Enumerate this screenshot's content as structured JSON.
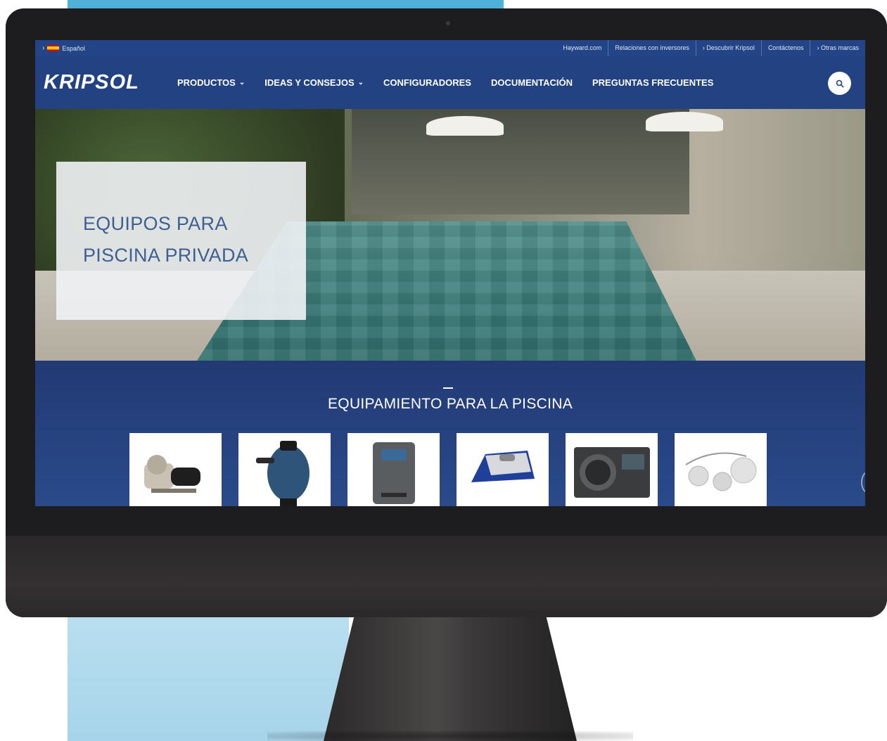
{
  "topbar": {
    "language": "Español",
    "links": [
      "Hayward.com",
      "Relaciones con inversores",
      "› Descubrir Kripsol",
      "Contáctenos",
      "› Otras marcas"
    ]
  },
  "navbar": {
    "logo": "KRIPSOL",
    "items": [
      {
        "label": "PRODUCTOS",
        "dropdown": true
      },
      {
        "label": "IDEAS Y CONSEJOS",
        "dropdown": true
      },
      {
        "label": "CONFIGURADORES",
        "dropdown": false
      },
      {
        "label": "DOCUMENTACIÓN",
        "dropdown": false
      },
      {
        "label": "PREGUNTAS FRECUENTES",
        "dropdown": false
      }
    ],
    "search_icon": "search-icon"
  },
  "hero": {
    "title_line1": "EQUIPOS PARA",
    "title_line2": "PISCINA PRIVADA"
  },
  "equipment": {
    "title": "EQUIPAMIENTO PARA LA PISCINA",
    "cards": [
      {
        "icon": "pool-pump-icon"
      },
      {
        "icon": "sand-filter-icon"
      },
      {
        "icon": "salt-chlorinator-icon"
      },
      {
        "icon": "pool-robot-icon"
      },
      {
        "icon": "heat-pump-icon"
      },
      {
        "icon": "pool-accessories-icon"
      }
    ]
  },
  "colors": {
    "nav_blue": "#224282",
    "section_blue": "#223a74",
    "hero_text": "#3f5f93",
    "accent_light_blue": "#4fb0d8"
  }
}
